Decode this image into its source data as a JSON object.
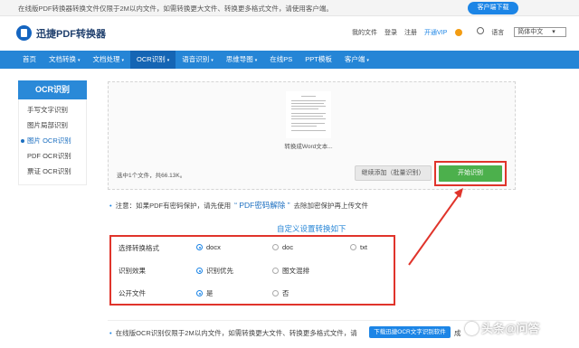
{
  "topbar": {
    "notice": "在线版PDF转换器转换文件仅限于2M以内文件，如需转换更大文件、转换更多格式文件，请使用客户端。",
    "download_button": "客户端下载"
  },
  "header": {
    "logo_text": "迅捷PDF转换器",
    "my_files": "我的文件",
    "login": "登录",
    "register": "注册",
    "open_vip": "开通VIP",
    "language_label": "语言",
    "language_value": "简体中文"
  },
  "nav": {
    "items": [
      {
        "label": "首页",
        "caret": ""
      },
      {
        "label": "文档转换",
        "caret": "▾"
      },
      {
        "label": "文档处理",
        "caret": "▾"
      },
      {
        "label": "OCR识别",
        "caret": "▾"
      },
      {
        "label": "语音识别",
        "caret": "▾"
      },
      {
        "label": "思维导图",
        "caret": "▾"
      },
      {
        "label": "在线PS",
        "caret": ""
      },
      {
        "label": "PPT模板",
        "caret": ""
      },
      {
        "label": "客户端",
        "caret": "▾"
      }
    ],
    "active_index": 3
  },
  "sidebar": {
    "title": "OCR识别",
    "items": [
      {
        "label": "手写文字识别"
      },
      {
        "label": "图片局部识别"
      },
      {
        "label": "图片 OCR识别"
      },
      {
        "label": "PDF OCR识别"
      },
      {
        "label": "票证 OCR识别"
      }
    ],
    "active_index": 2
  },
  "upload": {
    "thumbnail_label": "转换成Word文本...",
    "file_info": "选中1个文件，共66.13K。",
    "add_button": "继续添加（批量识别）",
    "start_button": "开始识别"
  },
  "note": {
    "bullet": "•",
    "prefix": "注意：如果PDF有密码保护，请先使用",
    "link": "“ PDF密码解除 ”",
    "suffix": "去除加密保护再上传文件"
  },
  "settings": {
    "title": "自定义设置转换如下",
    "rows": [
      {
        "label": "选择转换格式",
        "options": [
          {
            "label": "docx",
            "checked": true
          },
          {
            "label": "doc",
            "checked": false
          },
          {
            "label": "txt",
            "checked": false
          }
        ]
      },
      {
        "label": "识别效果",
        "options": [
          {
            "label": "识别优先",
            "checked": true
          },
          {
            "label": "图文混排",
            "checked": false
          }
        ]
      },
      {
        "label": "公开文件",
        "options": [
          {
            "label": "是",
            "checked": true
          },
          {
            "label": "否",
            "checked": false
          }
        ]
      }
    ]
  },
  "footnote": {
    "bullet": "•",
    "text": "在线版OCR识别仅限于2M以内文件，如需转换更大文件、转换更多格式文件，请",
    "button": "下载迅捷OCR文字识别软件",
    "more": "成"
  },
  "watermark": {
    "text": "头条@问答"
  },
  "colors": {
    "nav_blue": "#2585d6",
    "active_nav": "#1565b4",
    "start_green": "#4cb04c",
    "highlight_red": "#e0342b"
  }
}
